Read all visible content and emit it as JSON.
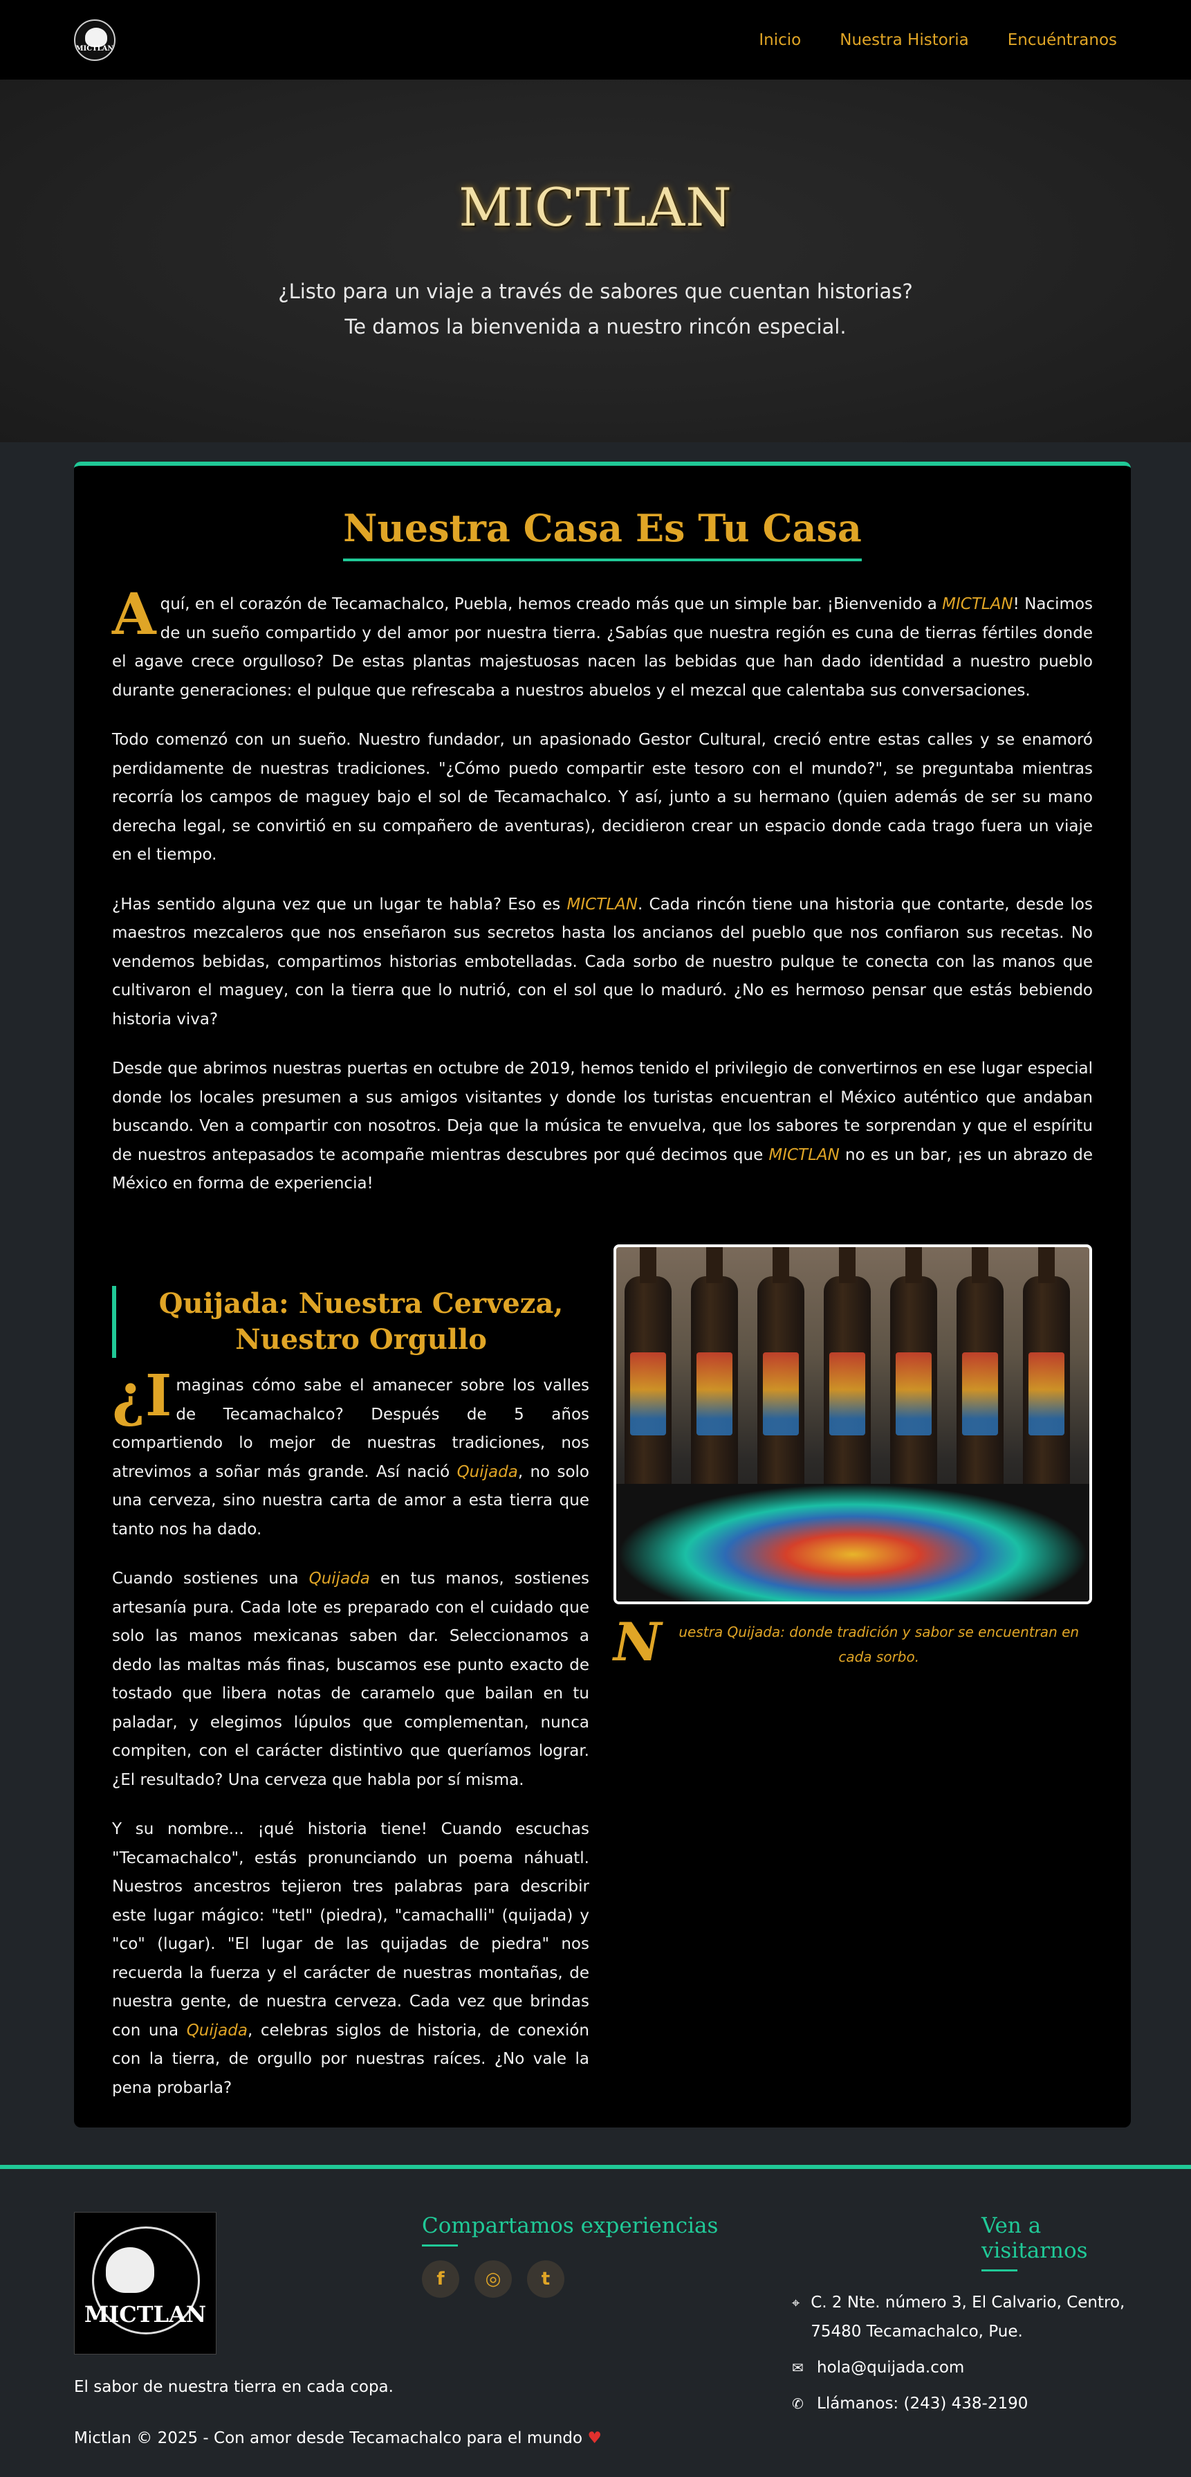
{
  "nav": {
    "logo_text": "MICTLAN",
    "links": [
      "Inicio",
      "Nuestra Historia",
      "Encuéntranos"
    ]
  },
  "hero": {
    "title": "MICTLAN",
    "subtitle": "¿Listo para un viaje a través de sabores que cuentan historias? Te damos la bienvenida a nuestro rincón especial."
  },
  "story": {
    "title": "Nuestra Casa Es Tu Casa",
    "p1": {
      "dropcap": "A",
      "before": "quí, en el corazón de Tecamachalco, Puebla, hemos creado más que un simple bar. ¡Bienvenido a ",
      "highlight": "MICTLAN",
      "after": "! Nacimos de un sueño compartido y del amor por nuestra tierra. ¿Sabías que nuestra región es cuna de tierras fértiles donde el agave crece orgulloso? De estas plantas majestuosas nacen las bebidas que han dado identidad a nuestro pueblo durante generaciones: el pulque que refrescaba a nuestros abuelos y el mezcal que calentaba sus conversaciones."
    },
    "p2": "Todo comenzó con un sueño. Nuestro fundador, un apasionado Gestor Cultural, creció entre estas calles y se enamoró perdidamente de nuestras tradiciones. \"¿Cómo puedo compartir este tesoro con el mundo?\", se preguntaba mientras recorría los campos de maguey bajo el sol de Tecamachalco. Y así, junto a su hermano (quien además de ser su mano derecha legal, se convirtió en su compañero de aventuras), decidieron crear un espacio donde cada trago fuera un viaje en el tiempo.",
    "p3": {
      "before": "¿Has sentido alguna vez que un lugar te habla? Eso es ",
      "highlight": "MICTLAN",
      "after": ". Cada rincón tiene una historia que contarte, desde los maestros mezcaleros que nos enseñaron sus secretos hasta los ancianos del pueblo que nos confiaron sus recetas. No vendemos bebidas, compartimos historias embotelladas. Cada sorbo de nuestro pulque te conecta con las manos que cultivaron el maguey, con la tierra que lo nutrió, con el sol que lo maduró. ¿No es hermoso pensar que estás bebiendo historia viva?"
    },
    "p4": {
      "before": "Desde que abrimos nuestras puertas en octubre de 2019, hemos tenido el privilegio de convertirnos en ese lugar especial donde los locales presumen a sus amigos visitantes y donde los turistas encuentran el México auténtico que andaban buscando. Ven a compartir con nosotros. Deja que la música te envuelva, que los sabores te sorprendan y que el espíritu de nuestros antepasados te acompañe mientras descubres por qué decimos que ",
      "highlight": "MICTLAN",
      "after": " no es un bar, ¡es un abrazo de México en forma de experiencia!"
    }
  },
  "beer": {
    "title": "Quijada: Nuestra Cerveza, Nuestro Orgullo",
    "p1": {
      "dropcap": "¿I",
      "before": "maginas cómo sabe el amanecer sobre los valles de Tecamachalco? Después de 5 años compartiendo lo mejor de nuestras tradiciones, nos atrevimos a soñar más grande. Así nació ",
      "highlight": "Quijada",
      "after": ", no solo una cerveza, sino nuestra carta de amor a esta tierra que tanto nos ha dado."
    },
    "p2": {
      "before": "Cuando sostienes una ",
      "highlight": "Quijada",
      "after": " en tus manos, sostienes artesanía pura. Cada lote es preparado con el cuidado que solo las manos mexicanas saben dar. Seleccionamos a dedo las maltas más finas, buscamos ese punto exacto de tostado que libera notas de caramelo que bailan en tu paladar, y elegimos lúpulos que complementan, nunca compiten, con el carácter distintivo que queríamos lograr. ¿El resultado? Una cerveza que habla por sí misma."
    },
    "p3": {
      "before": "Y su nombre... ¡qué historia tiene! Cuando escuchas \"Tecamachalco\", estás pronunciando un poema náhuatl. Nuestros ancestros tejieron tres palabras para describir este lugar mágico: \"tetl\" (piedra), \"camachalli\" (quijada) y \"co\" (lugar). \"El lugar de las quijadas de piedra\" nos recuerda la fuerza y el carácter de nuestras montañas, de nuestra gente, de nuestra cerveza. Cada vez que brindas con una ",
      "highlight": "Quijada",
      "after": ", celebras siglos de historia, de conexión con la tierra, de orgullo por nuestras raíces. ¿No vale la pena probarla?"
    },
    "caption": {
      "dropcap": "N",
      "text": "uestra Quijada: donde tradición y sabor se encuentran en cada sorbo."
    }
  },
  "footer": {
    "logo_text": "MICTLAN",
    "tagline": "El sabor de nuestra tierra en cada copa.",
    "copyright": "Mictlan © 2025 - Con amor desde Tecamachalco para el mundo",
    "heart": "♥",
    "social_title": "Compartamos experiencias",
    "social": [
      "f",
      "◎",
      "t"
    ],
    "visit_title": "Ven a visitarnos",
    "address": "C. 2 Nte. número 3, El Calvario, Centro, 75480 Tecamachalco, Pue.",
    "email": "hola@quijada.com",
    "phone": "Llámanos: (243) 438-2190"
  },
  "colors": {
    "accent": "#e0a526",
    "teal": "#20c997",
    "bg": "#212529"
  }
}
